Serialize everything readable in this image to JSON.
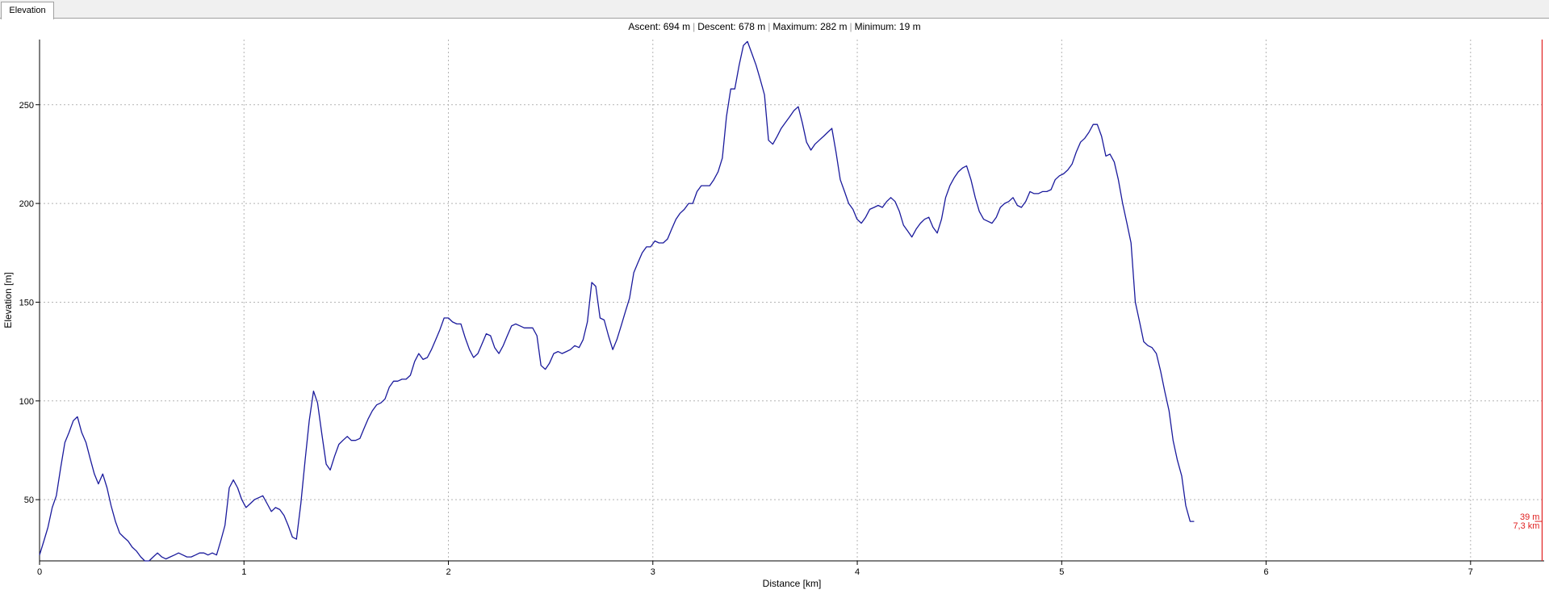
{
  "window": {
    "tab_label": "Elevation"
  },
  "stats": {
    "ascent": "Ascent: 694 m",
    "descent": "Descent: 678 m",
    "maximum": "Maximum: 282 m",
    "minimum": "Minimum: 19 m",
    "separator": "|"
  },
  "cursor": {
    "elevation_label": "39 m",
    "distance_label": "7,3 km",
    "distance_km": 7.35
  },
  "colors": {
    "line": "#1a1a9c",
    "cursor": "#e02020",
    "grid": "#b4b4b4"
  },
  "chart_data": {
    "type": "line",
    "title": "",
    "xlabel": "Distance [km]",
    "ylabel": "Elevation [m]",
    "xlim": [
      0,
      7.36
    ],
    "ylim": [
      19,
      283
    ],
    "x_ticks": [
      0,
      1,
      2,
      3,
      4,
      5,
      6,
      7
    ],
    "y_ticks": [
      50,
      100,
      150,
      200,
      250
    ],
    "grid": true,
    "legend": "none",
    "series": [
      {
        "points": [
          [
            0.0,
            22
          ],
          [
            0.021,
            29
          ],
          [
            0.041,
            36
          ],
          [
            0.062,
            46
          ],
          [
            0.082,
            52
          ],
          [
            0.103,
            66
          ],
          [
            0.124,
            79
          ],
          [
            0.144,
            84
          ],
          [
            0.165,
            90
          ],
          [
            0.185,
            92
          ],
          [
            0.206,
            84
          ],
          [
            0.227,
            79
          ],
          [
            0.247,
            71
          ],
          [
            0.268,
            63
          ],
          [
            0.288,
            58
          ],
          [
            0.309,
            63
          ],
          [
            0.33,
            56
          ],
          [
            0.35,
            47
          ],
          [
            0.371,
            39
          ],
          [
            0.392,
            33
          ],
          [
            0.412,
            31
          ],
          [
            0.433,
            29
          ],
          [
            0.453,
            26
          ],
          [
            0.474,
            24
          ],
          [
            0.495,
            21
          ],
          [
            0.515,
            19
          ],
          [
            0.536,
            19
          ],
          [
            0.556,
            21
          ],
          [
            0.577,
            23
          ],
          [
            0.598,
            21
          ],
          [
            0.618,
            20
          ],
          [
            0.639,
            21
          ],
          [
            0.66,
            22
          ],
          [
            0.68,
            23
          ],
          [
            0.701,
            22
          ],
          [
            0.721,
            21
          ],
          [
            0.742,
            21
          ],
          [
            0.763,
            22
          ],
          [
            0.783,
            23
          ],
          [
            0.804,
            23
          ],
          [
            0.824,
            22
          ],
          [
            0.845,
            23
          ],
          [
            0.866,
            22
          ],
          [
            0.886,
            29
          ],
          [
            0.907,
            37
          ],
          [
            0.928,
            56
          ],
          [
            0.948,
            60
          ],
          [
            0.969,
            56
          ],
          [
            0.989,
            50
          ],
          [
            1.01,
            46
          ],
          [
            1.031,
            48
          ],
          [
            1.051,
            50
          ],
          [
            1.072,
            51
          ],
          [
            1.092,
            52
          ],
          [
            1.113,
            48
          ],
          [
            1.134,
            44
          ],
          [
            1.154,
            46
          ],
          [
            1.175,
            45
          ],
          [
            1.196,
            42
          ],
          [
            1.216,
            37
          ],
          [
            1.237,
            31
          ],
          [
            1.257,
            30
          ],
          [
            1.278,
            48
          ],
          [
            1.299,
            70
          ],
          [
            1.319,
            90
          ],
          [
            1.34,
            105
          ],
          [
            1.36,
            99
          ],
          [
            1.381,
            83
          ],
          [
            1.402,
            68
          ],
          [
            1.422,
            65
          ],
          [
            1.443,
            72
          ],
          [
            1.464,
            78
          ],
          [
            1.484,
            80
          ],
          [
            1.505,
            82
          ],
          [
            1.525,
            80
          ],
          [
            1.546,
            80
          ],
          [
            1.567,
            81
          ],
          [
            1.587,
            86
          ],
          [
            1.608,
            91
          ],
          [
            1.628,
            95
          ],
          [
            1.649,
            98
          ],
          [
            1.67,
            99
          ],
          [
            1.69,
            101
          ],
          [
            1.711,
            107
          ],
          [
            1.732,
            110
          ],
          [
            1.752,
            110
          ],
          [
            1.773,
            111
          ],
          [
            1.793,
            111
          ],
          [
            1.814,
            113
          ],
          [
            1.835,
            120
          ],
          [
            1.855,
            124
          ],
          [
            1.876,
            121
          ],
          [
            1.897,
            122
          ],
          [
            1.917,
            126
          ],
          [
            1.938,
            131
          ],
          [
            1.958,
            136
          ],
          [
            1.979,
            142
          ],
          [
            2.0,
            142
          ],
          [
            2.02,
            140
          ],
          [
            2.041,
            139
          ],
          [
            2.061,
            139
          ],
          [
            2.082,
            132
          ],
          [
            2.103,
            126
          ],
          [
            2.123,
            122
          ],
          [
            2.144,
            124
          ],
          [
            2.165,
            129
          ],
          [
            2.185,
            134
          ],
          [
            2.206,
            133
          ],
          [
            2.226,
            127
          ],
          [
            2.247,
            124
          ],
          [
            2.268,
            128
          ],
          [
            2.288,
            133
          ],
          [
            2.309,
            138
          ],
          [
            2.329,
            139
          ],
          [
            2.35,
            138
          ],
          [
            2.371,
            137
          ],
          [
            2.391,
            137
          ],
          [
            2.412,
            137
          ],
          [
            2.433,
            133
          ],
          [
            2.453,
            118
          ],
          [
            2.474,
            116
          ],
          [
            2.494,
            119
          ],
          [
            2.515,
            124
          ],
          [
            2.536,
            125
          ],
          [
            2.556,
            124
          ],
          [
            2.577,
            125
          ],
          [
            2.597,
            126
          ],
          [
            2.618,
            128
          ],
          [
            2.639,
            127
          ],
          [
            2.659,
            131
          ],
          [
            2.68,
            140
          ],
          [
            2.701,
            160
          ],
          [
            2.721,
            158
          ],
          [
            2.742,
            142
          ],
          [
            2.762,
            141
          ],
          [
            2.783,
            133
          ],
          [
            2.804,
            126
          ],
          [
            2.824,
            131
          ],
          [
            2.845,
            138
          ],
          [
            2.865,
            145
          ],
          [
            2.886,
            152
          ],
          [
            2.907,
            165
          ],
          [
            2.927,
            170
          ],
          [
            2.948,
            175
          ],
          [
            2.969,
            178
          ],
          [
            2.989,
            178
          ],
          [
            3.01,
            181
          ],
          [
            3.03,
            180
          ],
          [
            3.051,
            180
          ],
          [
            3.072,
            182
          ],
          [
            3.092,
            187
          ],
          [
            3.113,
            192
          ],
          [
            3.133,
            195
          ],
          [
            3.154,
            197
          ],
          [
            3.175,
            200
          ],
          [
            3.195,
            200
          ],
          [
            3.216,
            206
          ],
          [
            3.237,
            209
          ],
          [
            3.257,
            209
          ],
          [
            3.278,
            209
          ],
          [
            3.298,
            212
          ],
          [
            3.319,
            216
          ],
          [
            3.34,
            223
          ],
          [
            3.36,
            244
          ],
          [
            3.381,
            258
          ],
          [
            3.401,
            258
          ],
          [
            3.422,
            270
          ],
          [
            3.443,
            280
          ],
          [
            3.463,
            282
          ],
          [
            3.484,
            276
          ],
          [
            3.505,
            270
          ],
          [
            3.525,
            263
          ],
          [
            3.546,
            255
          ],
          [
            3.566,
            232
          ],
          [
            3.587,
            230
          ],
          [
            3.608,
            234
          ],
          [
            3.628,
            238
          ],
          [
            3.649,
            241
          ],
          [
            3.67,
            244
          ],
          [
            3.69,
            247
          ],
          [
            3.711,
            249
          ],
          [
            3.731,
            241
          ],
          [
            3.752,
            231
          ],
          [
            3.773,
            227
          ],
          [
            3.793,
            230
          ],
          [
            3.814,
            232
          ],
          [
            3.835,
            234
          ],
          [
            3.855,
            236
          ],
          [
            3.876,
            238
          ],
          [
            3.896,
            226
          ],
          [
            3.917,
            212
          ],
          [
            3.938,
            206
          ],
          [
            3.958,
            200
          ],
          [
            3.979,
            197
          ],
          [
            3.999,
            192
          ],
          [
            4.02,
            190
          ],
          [
            4.041,
            193
          ],
          [
            4.061,
            197
          ],
          [
            4.082,
            198
          ],
          [
            4.102,
            199
          ],
          [
            4.123,
            198
          ],
          [
            4.144,
            201
          ],
          [
            4.164,
            203
          ],
          [
            4.185,
            201
          ],
          [
            4.206,
            196
          ],
          [
            4.226,
            189
          ],
          [
            4.247,
            186
          ],
          [
            4.267,
            183
          ],
          [
            4.288,
            187
          ],
          [
            4.309,
            190
          ],
          [
            4.329,
            192
          ],
          [
            4.35,
            193
          ],
          [
            4.37,
            188
          ],
          [
            4.391,
            185
          ],
          [
            4.412,
            192
          ],
          [
            4.432,
            203
          ],
          [
            4.453,
            209
          ],
          [
            4.474,
            213
          ],
          [
            4.494,
            216
          ],
          [
            4.515,
            218
          ],
          [
            4.535,
            219
          ],
          [
            4.556,
            212
          ],
          [
            4.577,
            203
          ],
          [
            4.597,
            196
          ],
          [
            4.618,
            192
          ],
          [
            4.638,
            191
          ],
          [
            4.659,
            190
          ],
          [
            4.68,
            193
          ],
          [
            4.7,
            198
          ],
          [
            4.721,
            200
          ],
          [
            4.741,
            201
          ],
          [
            4.762,
            203
          ],
          [
            4.783,
            199
          ],
          [
            4.803,
            198
          ],
          [
            4.824,
            201
          ],
          [
            4.845,
            206
          ],
          [
            4.865,
            205
          ],
          [
            4.886,
            205
          ],
          [
            4.906,
            206
          ],
          [
            4.927,
            206
          ],
          [
            4.948,
            207
          ],
          [
            4.968,
            212
          ],
          [
            4.989,
            214
          ],
          [
            5.009,
            215
          ],
          [
            5.03,
            217
          ],
          [
            5.051,
            220
          ],
          [
            5.071,
            226
          ],
          [
            5.092,
            231
          ],
          [
            5.113,
            233
          ],
          [
            5.133,
            236
          ],
          [
            5.154,
            240
          ],
          [
            5.174,
            240
          ],
          [
            5.195,
            234
          ],
          [
            5.216,
            224
          ],
          [
            5.236,
            225
          ],
          [
            5.257,
            221
          ],
          [
            5.277,
            212
          ],
          [
            5.298,
            200
          ],
          [
            5.319,
            190
          ],
          [
            5.339,
            180
          ],
          [
            5.36,
            150
          ],
          [
            5.381,
            140
          ],
          [
            5.401,
            130
          ],
          [
            5.422,
            128
          ],
          [
            5.442,
            127
          ],
          [
            5.463,
            124
          ],
          [
            5.484,
            115
          ],
          [
            5.504,
            105
          ],
          [
            5.525,
            95
          ],
          [
            5.545,
            80
          ],
          [
            5.566,
            70
          ],
          [
            5.587,
            62
          ],
          [
            5.607,
            47
          ],
          [
            5.628,
            39
          ],
          [
            5.648,
            39
          ]
        ]
      }
    ]
  }
}
